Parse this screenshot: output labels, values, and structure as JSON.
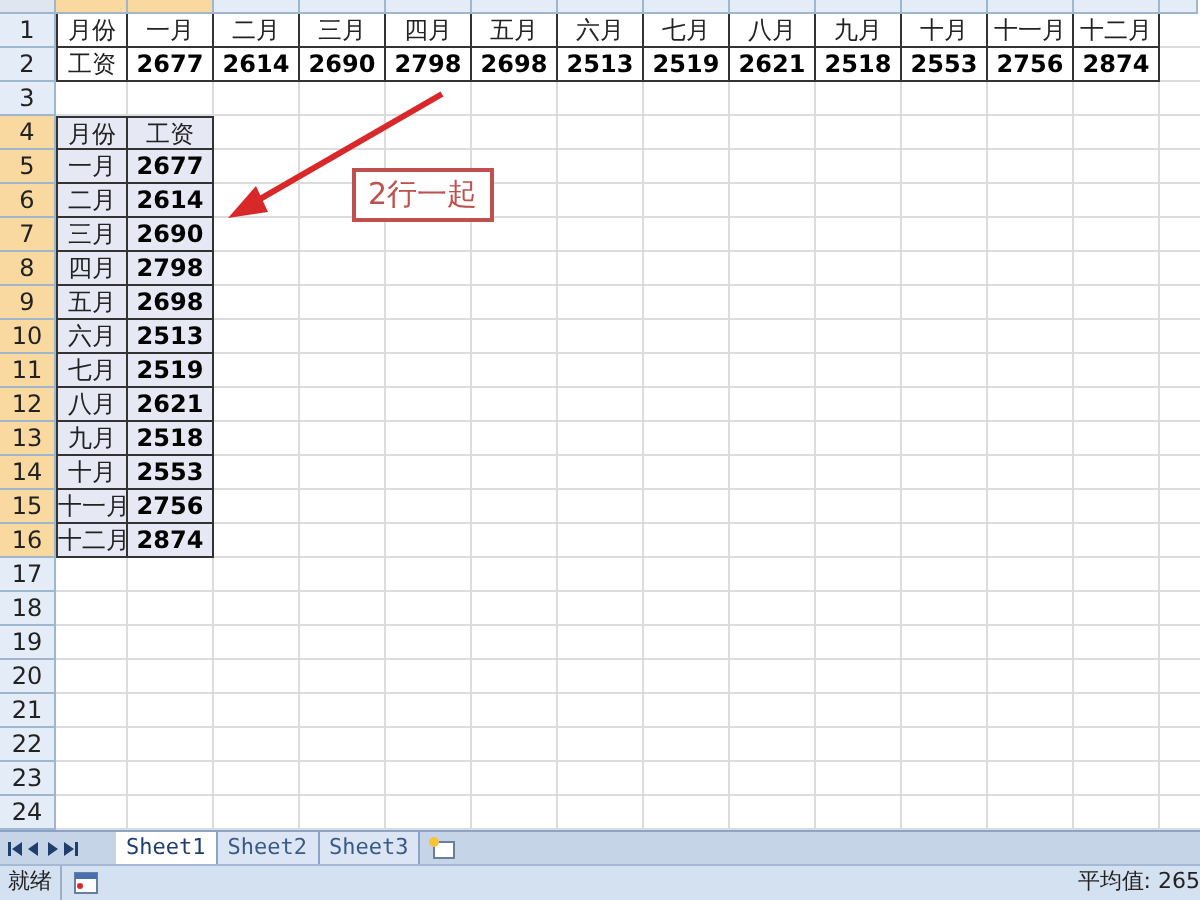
{
  "sheet": {
    "column_headers": [
      {
        "selected": true
      },
      {
        "selected": true
      },
      {
        "selected": false
      },
      {
        "selected": false
      },
      {
        "selected": false
      },
      {
        "selected": false
      },
      {
        "selected": false
      },
      {
        "selected": false
      },
      {
        "selected": false
      },
      {
        "selected": false
      },
      {
        "selected": false
      },
      {
        "selected": false
      },
      {
        "selected": false
      },
      {
        "selected": false
      }
    ],
    "rows": [
      {
        "number": "1",
        "kind": "header",
        "selected": false,
        "cells": [
          "月份",
          "一月",
          "二月",
          "三月",
          "四月",
          "五月",
          "六月",
          "七月",
          "八月",
          "九月",
          "十月",
          "十一月",
          "十二月"
        ]
      },
      {
        "number": "2",
        "kind": "data",
        "selected": false,
        "cells": [
          "工资",
          "2677",
          "2614",
          "2690",
          "2798",
          "2698",
          "2513",
          "2519",
          "2621",
          "2518",
          "2553",
          "2756",
          "2874"
        ]
      },
      {
        "number": "3",
        "kind": "data",
        "selected": false,
        "cells": []
      },
      {
        "number": "4",
        "kind": "header",
        "selected": true,
        "cells": [
          "月份",
          "工资"
        ]
      },
      {
        "number": "5",
        "kind": "data",
        "selected": true,
        "cells": [
          "一月",
          "2677"
        ]
      },
      {
        "number": "6",
        "kind": "data",
        "selected": true,
        "cells": [
          "二月",
          "2614"
        ]
      },
      {
        "number": "7",
        "kind": "data",
        "selected": true,
        "cells": [
          "三月",
          "2690"
        ]
      },
      {
        "number": "8",
        "kind": "data",
        "selected": true,
        "cells": [
          "四月",
          "2798"
        ]
      },
      {
        "number": "9",
        "kind": "data",
        "selected": true,
        "cells": [
          "五月",
          "2698"
        ]
      },
      {
        "number": "10",
        "kind": "data",
        "selected": true,
        "cells": [
          "六月",
          "2513"
        ]
      },
      {
        "number": "11",
        "kind": "data",
        "selected": true,
        "cells": [
          "七月",
          "2519"
        ]
      },
      {
        "number": "12",
        "kind": "data",
        "selected": true,
        "cells": [
          "八月",
          "2621"
        ]
      },
      {
        "number": "13",
        "kind": "data",
        "selected": true,
        "cells": [
          "九月",
          "2518"
        ]
      },
      {
        "number": "14",
        "kind": "data",
        "selected": true,
        "cells": [
          "十月",
          "2553"
        ]
      },
      {
        "number": "15",
        "kind": "data",
        "selected": true,
        "cells": [
          "十一月",
          "2756"
        ]
      },
      {
        "number": "16",
        "kind": "data",
        "selected": true,
        "cells": [
          "十二月",
          "2874"
        ]
      },
      {
        "number": "17",
        "kind": "data",
        "selected": false,
        "cells": []
      },
      {
        "number": "18",
        "kind": "data",
        "selected": false,
        "cells": []
      },
      {
        "number": "19",
        "kind": "data",
        "selected": false,
        "cells": []
      },
      {
        "number": "20",
        "kind": "data",
        "selected": false,
        "cells": []
      },
      {
        "number": "21",
        "kind": "data",
        "selected": false,
        "cells": []
      },
      {
        "number": "22",
        "kind": "data",
        "selected": false,
        "cells": []
      },
      {
        "number": "23",
        "kind": "data",
        "selected": false,
        "cells": []
      },
      {
        "number": "24",
        "kind": "data",
        "selected": false,
        "cells": []
      }
    ]
  },
  "annotation": {
    "text": "2行一起"
  },
  "sheet_tabs": [
    {
      "label": "Sheet1",
      "selected": true
    },
    {
      "label": "Sheet2",
      "selected": false
    },
    {
      "label": "Sheet3",
      "selected": false
    }
  ],
  "status_bar": {
    "mode": "就绪",
    "average": "平均值: 265"
  }
}
